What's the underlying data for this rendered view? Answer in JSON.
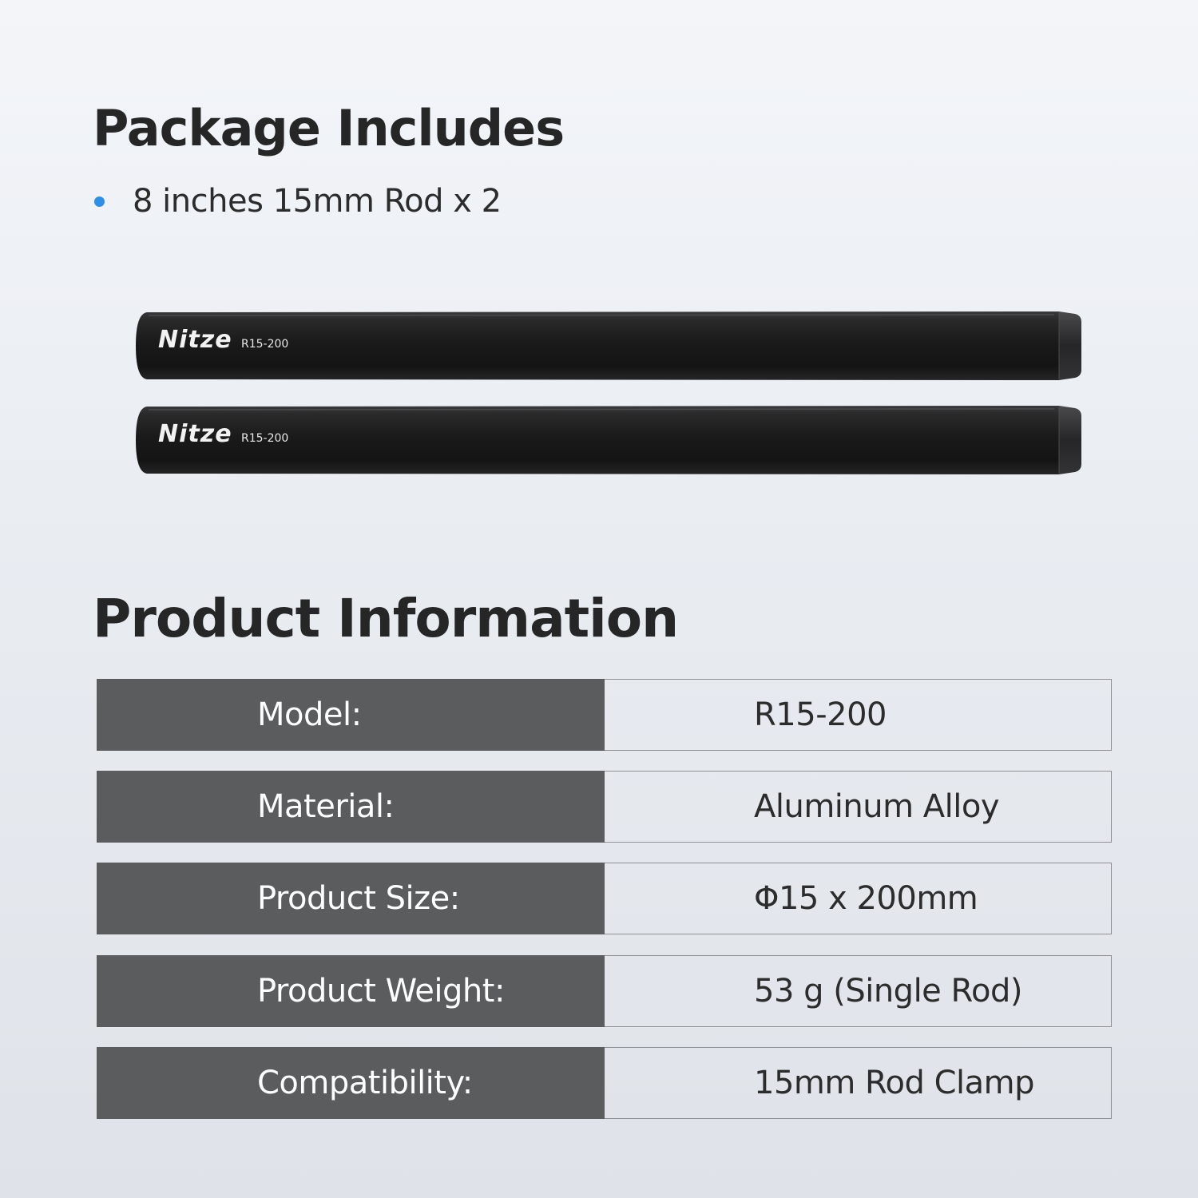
{
  "package": {
    "title": "Package Includes",
    "items": [
      {
        "text": "8 inches 15mm Rod x 2"
      }
    ],
    "bullet_color": "#2f8ee6"
  },
  "product_image": {
    "rods": [
      {
        "brand": "Nitze",
        "model": "R15-200"
      },
      {
        "brand": "Nitze",
        "model": "R15-200"
      }
    ],
    "rod_color": "#1c1c1d"
  },
  "info": {
    "title": "Product Information",
    "specs": [
      {
        "label": "Model:",
        "value": "R15-200"
      },
      {
        "label": "Material:",
        "value": "Aluminum Alloy"
      },
      {
        "label": "Product Size:",
        "value": "Φ15 x 200mm"
      },
      {
        "label": "Product Weight:",
        "value": "53 g (Single Rod)"
      },
      {
        "label": "Compatibility:",
        "value": "15mm Rod Clamp"
      }
    ],
    "label_cell_color": "#5b5c5e"
  }
}
